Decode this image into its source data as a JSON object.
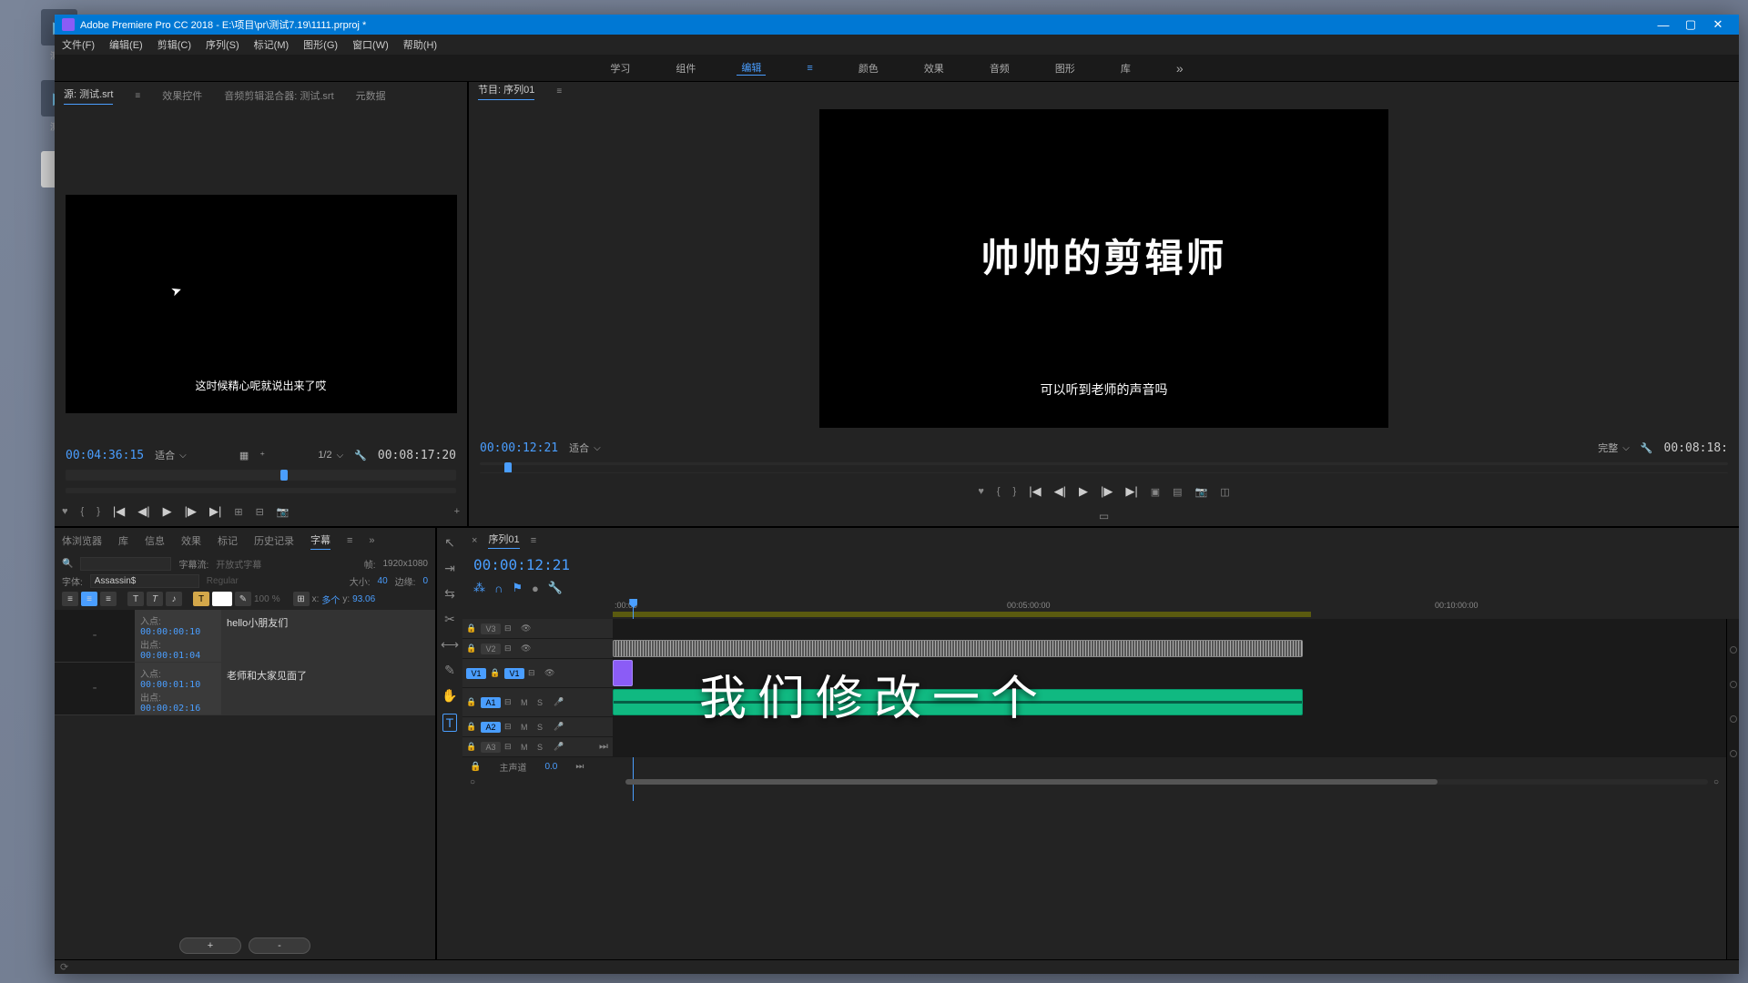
{
  "title_bar": {
    "text": "Adobe Premiere Pro CC 2018 - E:\\项目\\pr\\测试7.19\\1111.prproj *"
  },
  "menu": {
    "file": "文件(F)",
    "edit": "编辑(E)",
    "clip": "剪辑(C)",
    "sequence": "序列(S)",
    "markers": "标记(M)",
    "graphics": "图形(G)",
    "window": "窗口(W)",
    "help": "帮助(H)"
  },
  "workspace": {
    "learn": "学习",
    "assembly": "组件",
    "editing": "编辑",
    "color": "颜色",
    "effects": "效果",
    "audio": "音频",
    "graphics": "图形",
    "library": "库"
  },
  "source_tabs": {
    "source": "源: 测试.srt",
    "effect_controls": "效果控件",
    "audio_mixer": "音频剪辑混合器: 测试.srt",
    "metadata": "元数据"
  },
  "source_panel": {
    "subtitle": "这时候精心呢就说出来了哎",
    "timecode_in": "00:04:36:15",
    "fit": "适合",
    "playback": "1/2",
    "timecode_out": "00:08:17:20"
  },
  "program_tabs": {
    "program": "节目: 序列01"
  },
  "program_panel": {
    "title_text": "帅帅的剪辑师",
    "subtitle": "可以听到老师的声音吗",
    "timecode_in": "00:00:12:21",
    "fit": "适合",
    "quality": "完整",
    "timecode_out": "00:08:18:"
  },
  "caption_tabs": {
    "browser": "体浏览器",
    "library": "库",
    "info": "信息",
    "effects": "效果",
    "markers": "标记",
    "history": "历史记录",
    "captions": "字幕"
  },
  "caption_panel": {
    "stream_label": "字幕流:",
    "stream_value": "开放式字幕",
    "fps_label": "帧:",
    "fps_value": "1920x1080",
    "font_label": "字体:",
    "font_value": "Assassin$",
    "font_style": "Regular",
    "size_label": "大小:",
    "size_value": "40",
    "edge_label": "边缘:",
    "edge_value": "0",
    "opacity": "100",
    "x_label": "x:",
    "x_value": "多个",
    "y_label": "y:",
    "y_value": "93.06",
    "items": [
      {
        "in_label": "入点:",
        "in": "00:00:00:10",
        "out_label": "出点:",
        "out": "00:00:01:04",
        "text": "hello小朋友们"
      },
      {
        "in_label": "入点:",
        "in": "00:00:01:10",
        "out_label": "出点:",
        "out": "00:00:02:16",
        "text": "老师和大家见面了"
      }
    ],
    "add": "+",
    "remove": "-"
  },
  "timeline": {
    "seq_name": "序列01",
    "timecode": "00:00:12:21",
    "ruler": {
      "t0": ":00:00",
      "t1": "00:05:00:00",
      "t2": "00:10:00:00"
    },
    "tracks": {
      "v3": "V3",
      "v2": "V2",
      "v1": "V1",
      "a1": "A1",
      "a2": "A2",
      "a3": "A3"
    },
    "master_label": "主声道",
    "master_val": "0.0",
    "mute": "M",
    "solo": "S"
  },
  "desktop": {
    "icon1": "测试",
    "icon2": "测试"
  },
  "overlay": "我们修改一个"
}
